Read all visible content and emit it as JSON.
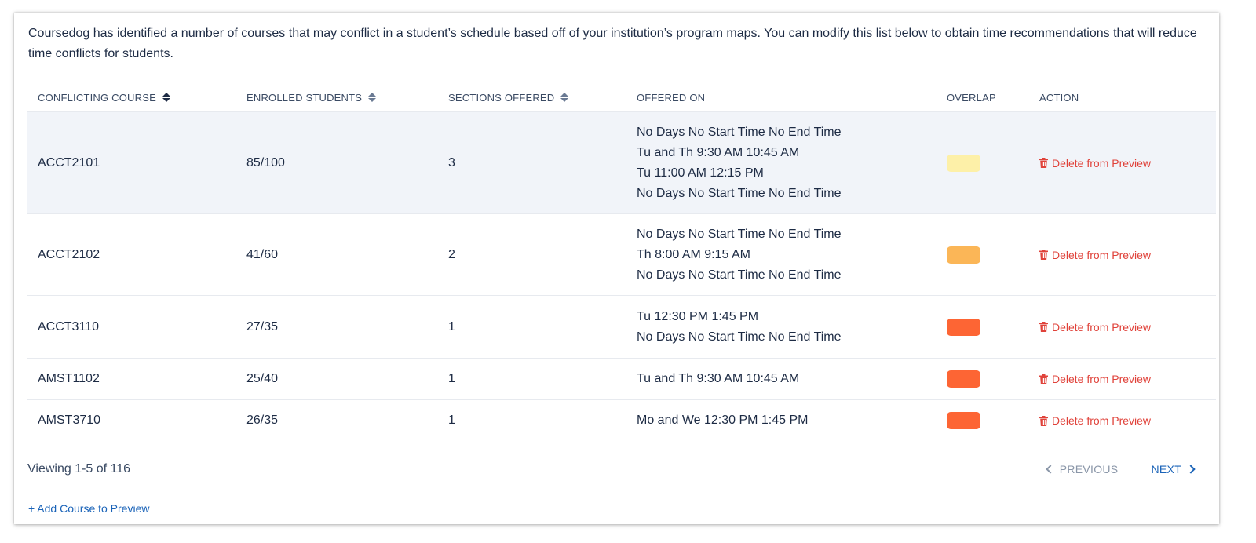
{
  "intro_text": "Coursedog has identified a number of courses that may conflict in a student’s schedule based off of your institution’s program maps. You can modify this list below to obtain time recommendations that will reduce time conflicts for students.",
  "columns": {
    "course": "CONFLICTING COURSE",
    "enrolled": "ENROLLED STUDENTS",
    "sections": "SECTIONS OFFERED",
    "offered": "OFFERED ON",
    "overlap": "OVERLAP",
    "action": "ACTION"
  },
  "rows": [
    {
      "course": "ACCT2101",
      "enrolled": "85/100",
      "sections": "3",
      "offered": [
        "No Days No Start Time No End Time",
        "Tu and Th 9:30 AM 10:45 AM",
        "Tu 11:00 AM 12:15 PM",
        "No Days No Start Time No End Time"
      ],
      "overlap_color": "#fdf0a8",
      "action": "Delete from Preview"
    },
    {
      "course": "ACCT2102",
      "enrolled": "41/60",
      "sections": "2",
      "offered": [
        "No Days No Start Time No End Time",
        "Th 8:00 AM 9:15 AM",
        "No Days No Start Time No End Time"
      ],
      "overlap_color": "#fbb657",
      "action": "Delete from Preview"
    },
    {
      "course": "ACCT3110",
      "enrolled": "27/35",
      "sections": "1",
      "offered": [
        "Tu 12:30 PM 1:45 PM",
        "No Days No Start Time No End Time"
      ],
      "overlap_color": "#fd6534",
      "action": "Delete from Preview"
    },
    {
      "course": "AMST1102",
      "enrolled": "25/40",
      "sections": "1",
      "offered": [
        "Tu and Th 9:30 AM 10:45 AM"
      ],
      "overlap_color": "#fd6534",
      "action": "Delete from Preview"
    },
    {
      "course": "AMST3710",
      "enrolled": "26/35",
      "sections": "1",
      "offered": [
        "Mo and We 12:30 PM 1:45 PM"
      ],
      "overlap_color": "#fd6534",
      "action": "Delete from Preview"
    }
  ],
  "footer": {
    "viewing": "Viewing 1-5 of 116",
    "previous": "PREVIOUS",
    "next": "NEXT"
  },
  "add_link": "+ Add Course to Preview",
  "colors": {
    "delete_red": "#e0423a",
    "link_blue": "#1a63b8",
    "highlight_row": "#f1f4f9"
  }
}
